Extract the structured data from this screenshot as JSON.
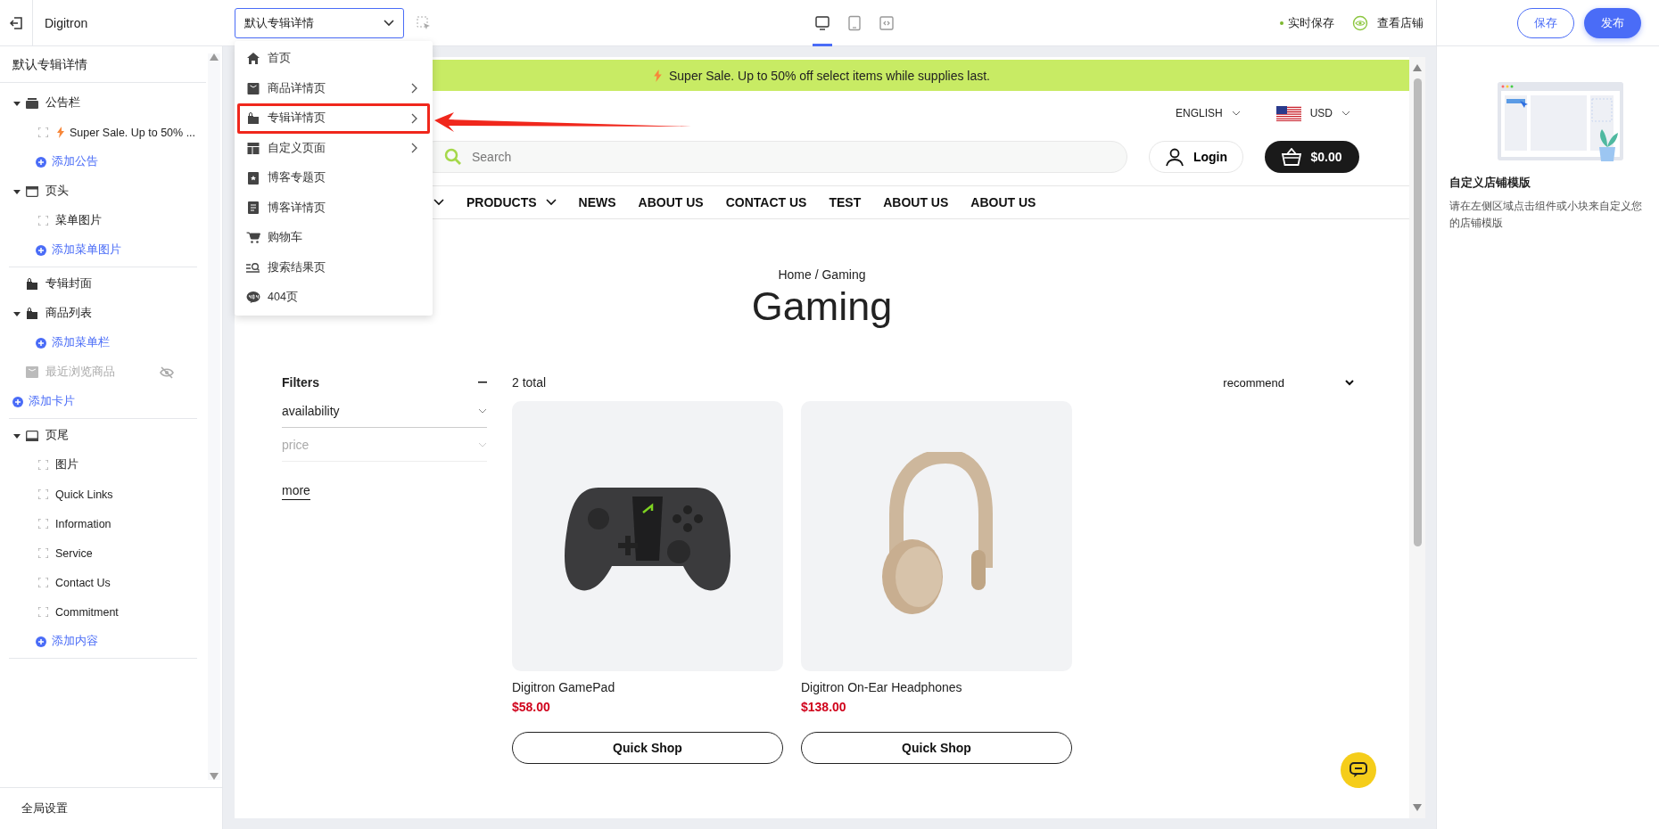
{
  "topbar": {
    "brand": "Digitron",
    "page_select": {
      "value": "默认专辑详情",
      "open": true,
      "options": [
        {
          "label": "首页",
          "submenu": false,
          "highlighted": false
        },
        {
          "label": "商品详情页",
          "submenu": true,
          "highlighted": false
        },
        {
          "label": "专辑详情页",
          "submenu": true,
          "highlighted": true
        },
        {
          "label": "自定义页面",
          "submenu": true,
          "highlighted": false
        },
        {
          "label": "博客专题页",
          "submenu": false,
          "highlighted": false
        },
        {
          "label": "博客详情页",
          "submenu": false,
          "highlighted": false
        },
        {
          "label": "购物车",
          "submenu": false,
          "highlighted": false
        },
        {
          "label": "搜索结果页",
          "submenu": false,
          "highlighted": false
        },
        {
          "label": "404页",
          "submenu": false,
          "highlighted": false
        }
      ]
    },
    "devices": [
      {
        "kind": "desktop",
        "selected": true
      },
      {
        "kind": "tablet",
        "selected": false
      },
      {
        "kind": "code",
        "selected": false
      }
    ],
    "autosave": "实时保存",
    "view_store": "查看店铺",
    "buttons": [
      {
        "label": "保存",
        "kind": "outline"
      },
      {
        "label": "发布",
        "kind": "primary"
      }
    ]
  },
  "sidebar": {
    "title": "默认专辑详情",
    "sections": [
      {
        "items": [
          {
            "kind": "group",
            "label": "公告栏",
            "expanded": true,
            "children": [
              {
                "kind": "announcement",
                "label": "Super Sale. Up to 50% ..."
              },
              {
                "kind": "add",
                "label": "添加公告"
              }
            ]
          },
          {
            "kind": "group",
            "label": "页头",
            "expanded": true,
            "children": [
              {
                "kind": "block",
                "label": "菜单图片"
              },
              {
                "kind": "add",
                "label": "添加菜单图片"
              }
            ]
          }
        ]
      },
      {
        "items": [
          {
            "kind": "card",
            "label": "专辑封面",
            "hidden": false
          },
          {
            "kind": "group",
            "label": "商品列表",
            "expanded": true,
            "children": [
              {
                "kind": "add",
                "label": "添加菜单栏"
              }
            ]
          },
          {
            "kind": "card",
            "label": "最近浏览商品",
            "hidden": true
          },
          {
            "kind": "add",
            "label": "添加卡片"
          }
        ]
      },
      {
        "items": [
          {
            "kind": "group",
            "label": "页尾",
            "expanded": true,
            "children": [
              {
                "kind": "block",
                "label": "图片"
              },
              {
                "kind": "block",
                "label": "Quick Links"
              },
              {
                "kind": "block",
                "label": "Information"
              },
              {
                "kind": "block",
                "label": "Service"
              },
              {
                "kind": "block",
                "label": "Contact Us"
              },
              {
                "kind": "block",
                "label": "Commitment"
              },
              {
                "kind": "add",
                "label": "添加内容"
              }
            ]
          }
        ]
      }
    ],
    "footer": "全局设置"
  },
  "preview": {
    "announcement": "Super Sale. Up to 50% off select items while supplies last.",
    "language": "ENGLISH",
    "currency": "USD",
    "search": {
      "placeholder": "Search"
    },
    "login": "Login",
    "cart": "$0.00",
    "nav": [
      {
        "dropdown": true
      },
      {
        "label": "PRODUCTS",
        "dropdown": true
      },
      {
        "label": "NEWS",
        "dropdown": false
      },
      {
        "label": "ABOUT US",
        "dropdown": false
      },
      {
        "label": "CONTACT US",
        "dropdown": false
      },
      {
        "label": "TEST",
        "dropdown": false
      },
      {
        "label": "ABOUT US",
        "dropdown": false
      },
      {
        "label": "ABOUT US",
        "dropdown": false
      }
    ],
    "breadcrumb": "Home / Gaming",
    "title": "Gaming",
    "filters": {
      "title": "Filters",
      "items": [
        {
          "label": "availability",
          "disabled": false
        },
        {
          "label": "price",
          "disabled": true
        }
      ],
      "more": "more"
    },
    "total": "2 total",
    "sort": "recommend",
    "products": [
      {
        "kind": "gamepad",
        "name": "Digitron GamePad",
        "price": "$58.00",
        "button": "Quick Shop"
      },
      {
        "kind": "headphones",
        "name": "Digitron On-Ear Headphones",
        "price": "$138.00",
        "button": "Quick Shop"
      }
    ]
  },
  "panel": {
    "title": "自定义店铺模版",
    "description": "请在左侧区域点击组件或小块来自定义您的店铺模版"
  }
}
